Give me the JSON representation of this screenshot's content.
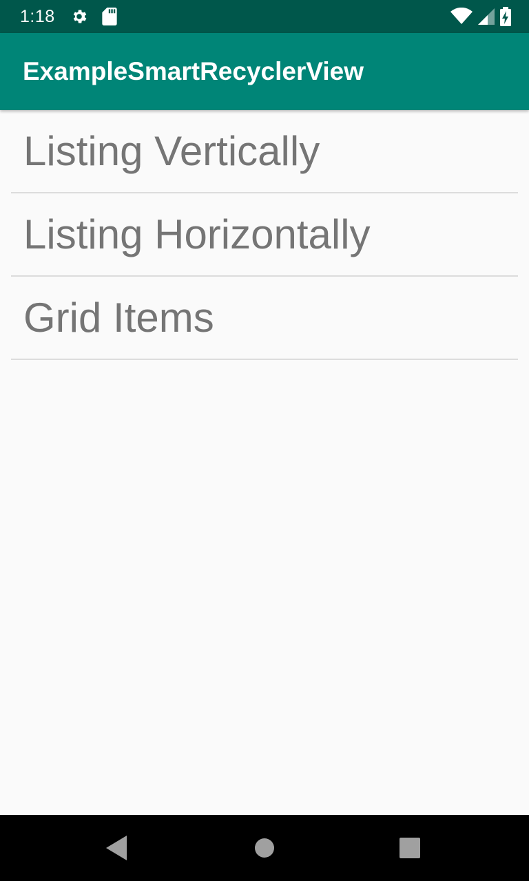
{
  "status_bar": {
    "time": "1:18",
    "left_icons": [
      "settings-icon",
      "sd-card-icon"
    ],
    "right_icons": [
      "wifi-icon",
      "cell-signal-icon",
      "battery-charging-icon"
    ],
    "background": "#00574b"
  },
  "app_bar": {
    "title": "ExampleSmartRecyclerView",
    "background": "#008577"
  },
  "list": {
    "items": [
      {
        "label": "Listing Vertically"
      },
      {
        "label": "Listing Horizontally"
      },
      {
        "label": "Grid Items"
      }
    ],
    "text_color": "#757575",
    "divider_color": "#dcdcdc"
  },
  "nav_bar": {
    "buttons": [
      "back-icon",
      "home-icon",
      "recents-icon"
    ],
    "background": "#000000",
    "icon_color": "#a0a0a0"
  }
}
